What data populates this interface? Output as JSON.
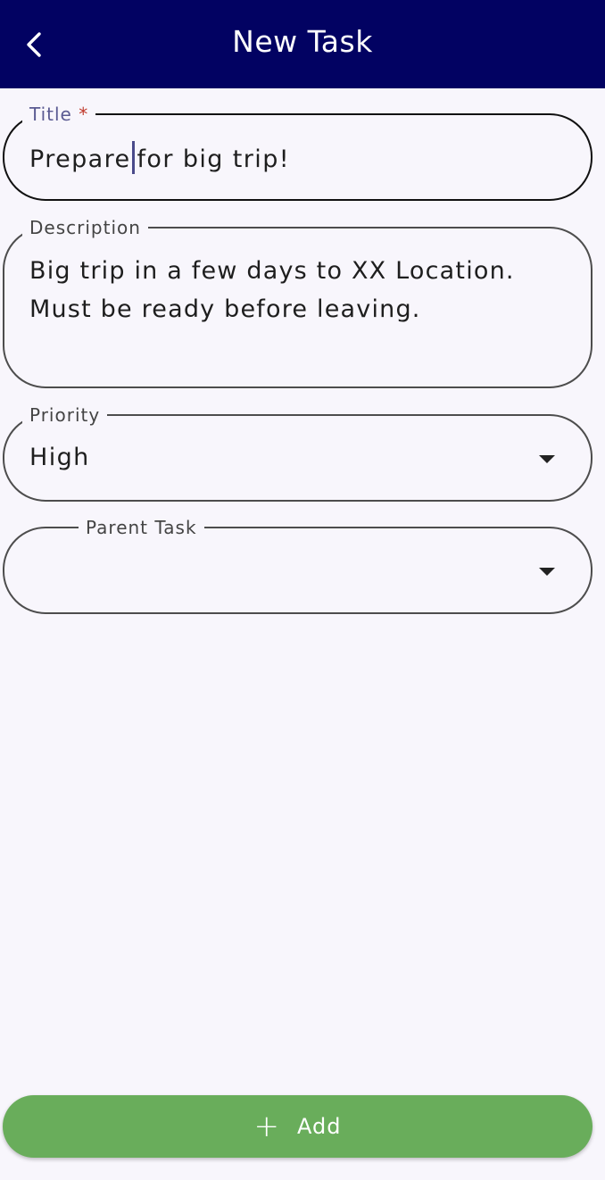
{
  "header": {
    "title": "New Task",
    "back_icon": "chevron-left-icon",
    "background_color": "#020262"
  },
  "form": {
    "title": {
      "label": "Title",
      "required_marker": "*",
      "value_before_cursor": "Prepare",
      "value_after_cursor": "for big trip!"
    },
    "description": {
      "label": "Description",
      "lines": [
        "Big trip in a few days to XX Location.",
        "Must be ready before leaving."
      ]
    },
    "priority": {
      "label": "Priority",
      "value": "High",
      "icon": "dropdown-arrow-icon"
    },
    "parent_task": {
      "label": "Parent Task",
      "value": "",
      "icon": "dropdown-arrow-icon"
    }
  },
  "add_button": {
    "icon": "+",
    "label": "Add",
    "color": "#69ad5b"
  }
}
